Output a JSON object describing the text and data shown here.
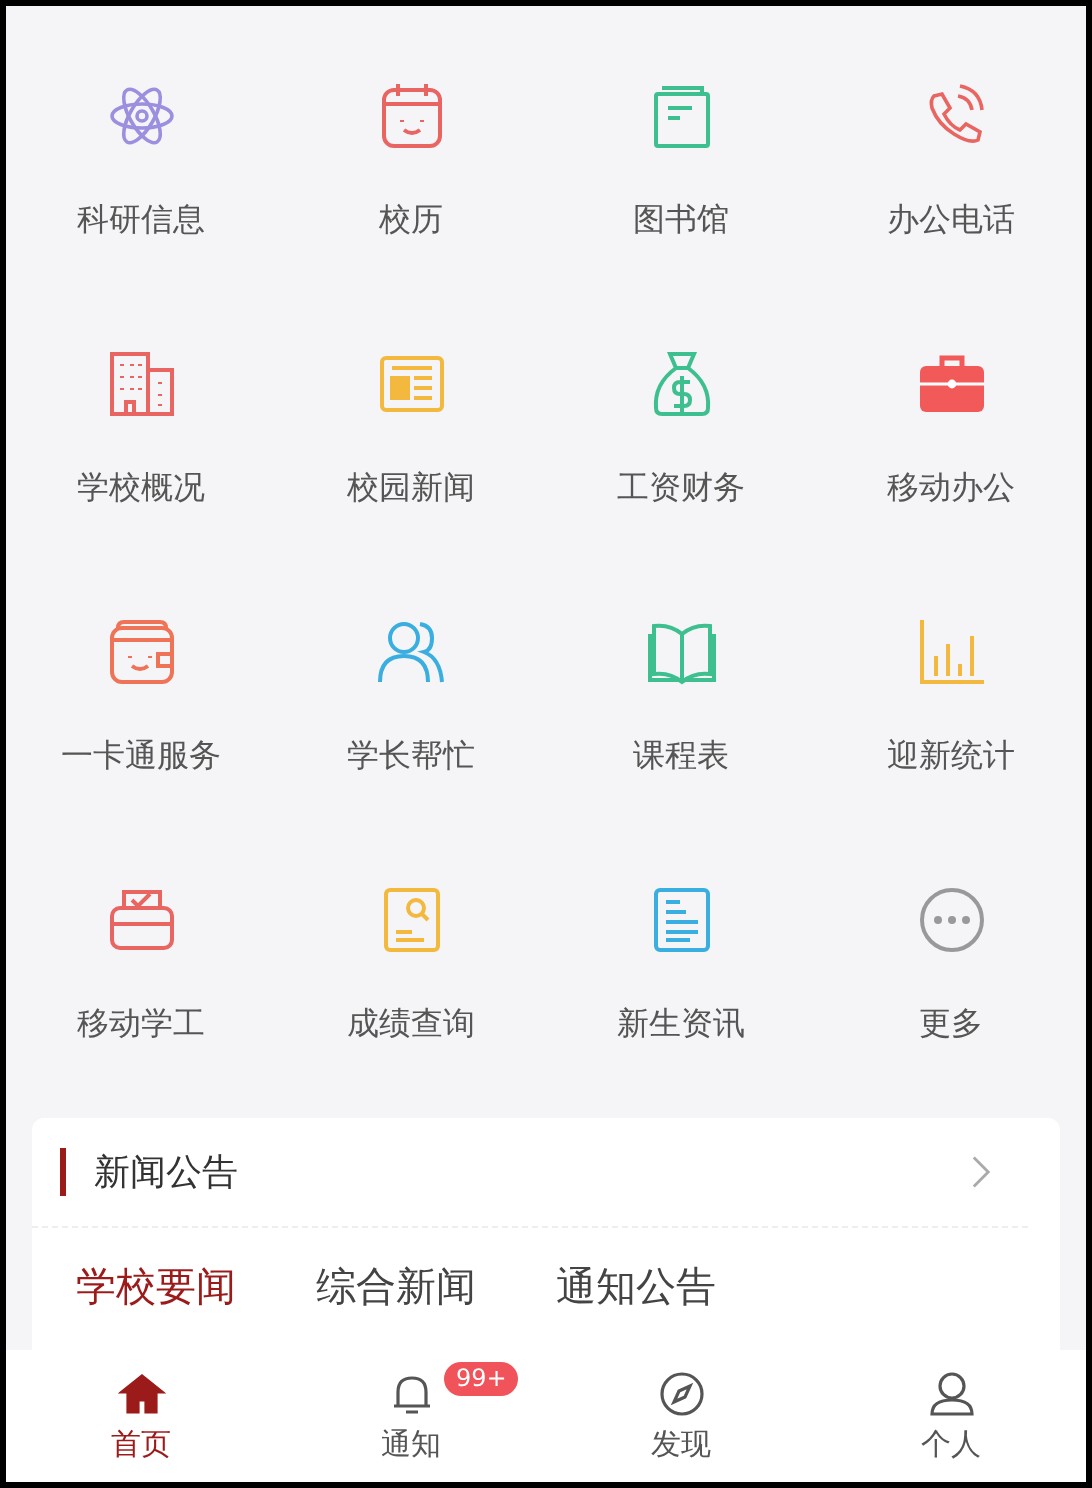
{
  "services": [
    {
      "label": "科研信息",
      "kind": "atom"
    },
    {
      "label": "校历",
      "kind": "calendar"
    },
    {
      "label": "图书馆",
      "kind": "notebook"
    },
    {
      "label": "办公电话",
      "kind": "phone"
    },
    {
      "label": "学校概况",
      "kind": "building"
    },
    {
      "label": "校园新闻",
      "kind": "newspaper"
    },
    {
      "label": "工资财务",
      "kind": "moneybag"
    },
    {
      "label": "移动办公",
      "kind": "briefcase"
    },
    {
      "label": "一卡通服务",
      "kind": "wallet"
    },
    {
      "label": "学长帮忙",
      "kind": "people"
    },
    {
      "label": "课程表",
      "kind": "openbook"
    },
    {
      "label": "迎新统计",
      "kind": "barchart"
    },
    {
      "label": "移动学工",
      "kind": "ballot"
    },
    {
      "label": "成绩查询",
      "kind": "searchdoc"
    },
    {
      "label": "新生资讯",
      "kind": "document"
    },
    {
      "label": "更多",
      "kind": "more"
    }
  ],
  "news": {
    "title": "新闻公告",
    "tabs": [
      {
        "label": "学校要闻",
        "selected": true
      },
      {
        "label": "综合新闻",
        "selected": false
      },
      {
        "label": "通知公告",
        "selected": false
      }
    ]
  },
  "nav": [
    {
      "label": "首页",
      "kind": "home",
      "selected": true
    },
    {
      "label": "通知",
      "kind": "bell",
      "selected": false,
      "badge": "99+"
    },
    {
      "label": "发现",
      "kind": "compass",
      "selected": false
    },
    {
      "label": "个人",
      "kind": "person",
      "selected": false
    }
  ]
}
